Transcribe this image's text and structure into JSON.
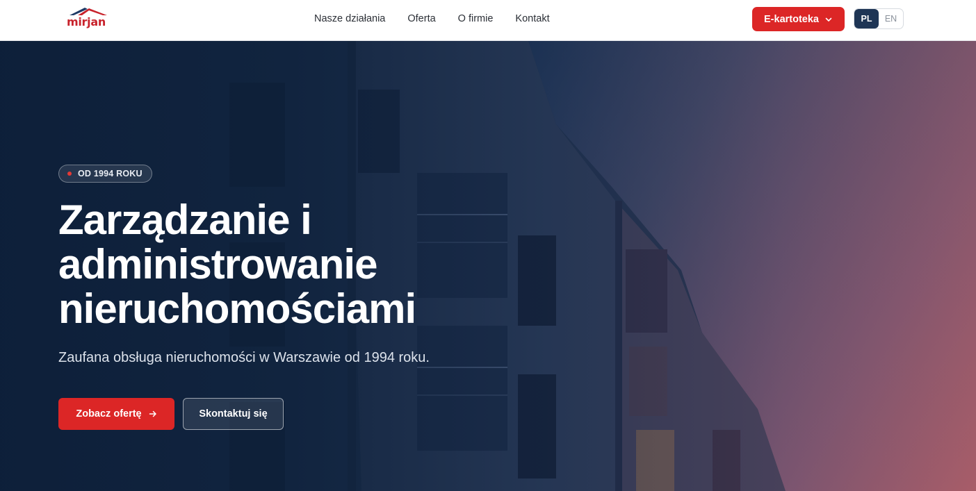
{
  "brand": {
    "logo_text": "mirjan",
    "brand_color": "#c8232c"
  },
  "nav": {
    "items": [
      {
        "label": "Nasze działania"
      },
      {
        "label": "Oferta"
      },
      {
        "label": "O firmie"
      },
      {
        "label": "Kontakt"
      }
    ]
  },
  "header_actions": {
    "ekartoteka_label": "E-kartoteka",
    "ekartoteka_icon": "chevron-down-icon",
    "languages": [
      {
        "code": "PL",
        "active": true
      },
      {
        "code": "EN",
        "active": false
      }
    ]
  },
  "hero": {
    "badge": "OD 1994 ROKU",
    "headline_lines": [
      "Zarządzanie i",
      "administrowanie",
      "nieruchomościami"
    ],
    "subtitle": "Zaufana obsługa nieruchomości w Warszawie od 1994 roku.",
    "primary_cta": "Zobacz ofertę",
    "primary_cta_icon": "arrow-right-icon",
    "secondary_cta": "Skontaktuj się",
    "background_image": "apartment-building-photo"
  },
  "colors": {
    "accent": "#dc2626",
    "navy": "#1e3555",
    "hero_dark": "#0f2440",
    "hero_warm": "#a75e6a"
  }
}
